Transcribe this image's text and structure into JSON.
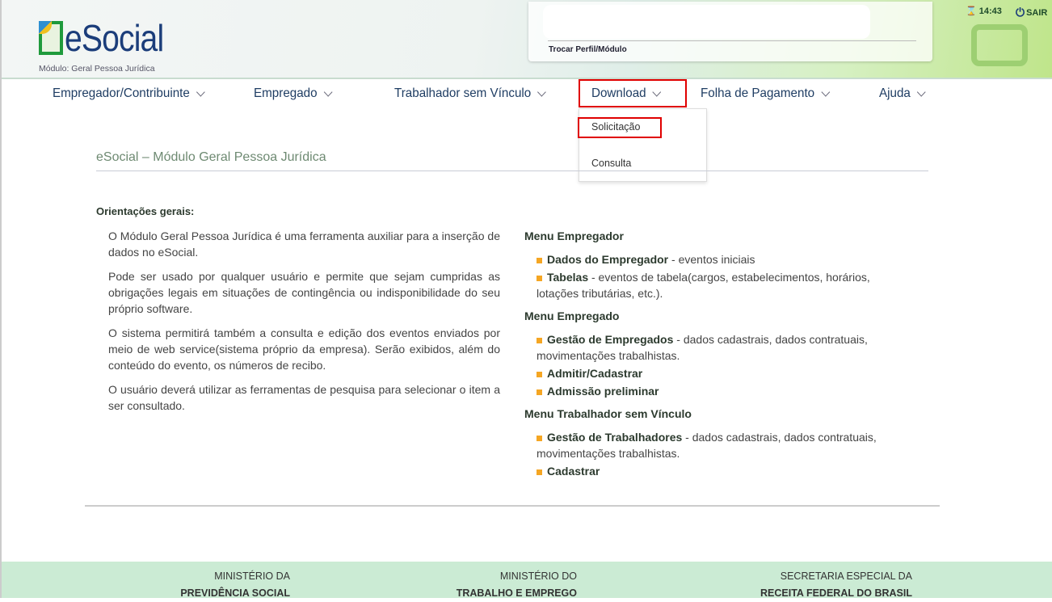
{
  "header": {
    "logo_text": "eSocial",
    "module": "Módulo: Geral Pessoa Jurídica",
    "switch_profile": "Trocar Perfil/Módulo",
    "time": "14:43",
    "logout": "SAIR"
  },
  "nav": {
    "items": [
      {
        "label": "Empregador/Contribuinte"
      },
      {
        "label": "Empregado"
      },
      {
        "label": "Trabalhador sem Vínculo"
      },
      {
        "label": "Download"
      },
      {
        "label": "Folha de Pagamento"
      },
      {
        "label": "Ajuda"
      }
    ],
    "dropdown": [
      {
        "label": "Solicitação"
      },
      {
        "label": "Consulta"
      }
    ]
  },
  "highlight_color": "#e00000",
  "main": {
    "title": "eSocial – Módulo Geral Pessoa Jurídica",
    "orient_heading": "Orientações gerais:",
    "paragraphs": [
      "O Módulo Geral Pessoa Jurídica é uma ferramenta auxiliar para a inserção de dados no eSocial.",
      "Pode ser usado por qualquer usuário e permite que sejam cumpridas as obrigações legais em situações de contingência ou indisponibilidade do seu próprio software.",
      "O sistema permitirá também a consulta e edição dos eventos enviados por meio de web service(sistema próprio da empresa). Serão exibidos, além do conteúdo do evento, os números de recibo.",
      "O usuário deverá utilizar as ferramentas de pesquisa para selecionar o item a ser consultado."
    ],
    "sections": [
      {
        "title": "Menu Empregador",
        "items": [
          {
            "bold": "Dados do Empregador",
            "text": " - eventos iniciais"
          },
          {
            "bold": "Tabelas",
            "text": " - eventos de tabela(cargos, estabelecimentos, horários, lotações tributárias, etc.)."
          }
        ]
      },
      {
        "title": "Menu Empregado",
        "items": [
          {
            "bold": "Gestão de Empregados",
            "text": " - dados cadastrais, dados contratuais, movimentações trabalhistas."
          },
          {
            "bold": "Admitir/Cadastrar",
            "text": ""
          },
          {
            "bold": "Admissão preliminar",
            "text": ""
          }
        ]
      },
      {
        "title": "Menu Trabalhador sem Vínculo",
        "items": [
          {
            "bold": "Gestão de Trabalhadores",
            "text": " - dados cadastrais, dados contratuais, movimentações trabalhistas."
          },
          {
            "bold": "Cadastrar",
            "text": ""
          }
        ]
      }
    ]
  },
  "footer": [
    {
      "top": "MINISTÉRIO DA",
      "bottom": "PREVIDÊNCIA SOCIAL"
    },
    {
      "top": "MINISTÉRIO DO",
      "bottom": "TRABALHO E EMPREGO"
    },
    {
      "top": "SECRETARIA ESPECIAL DA",
      "bottom": "RECEITA FEDERAL DO BRASIL"
    }
  ]
}
